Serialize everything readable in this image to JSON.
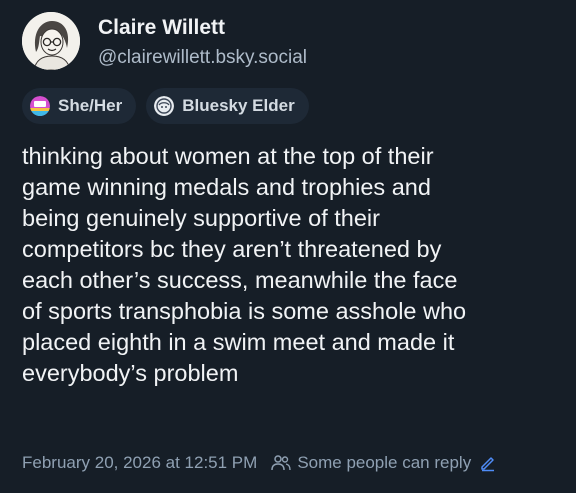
{
  "author": {
    "display_name": "Claire Willett",
    "handle": "@clairewillett.bsky.social",
    "avatar_icon": "user-avatar"
  },
  "badges": [
    {
      "label": "She/Her",
      "icon": "pronoun-badge-icon"
    },
    {
      "label": "Bluesky Elder",
      "icon": "elder-badge-icon"
    }
  ],
  "post": {
    "text": "thinking about women at the top of their\ngame winning medals and trophies and\nbeing genuinely supportive of their\ncompetitors bc they aren’t threatened by\neach other’s success, meanwhile the face\nof sports transphobia is some asshole who\nplaced eighth in a swim meet and made it\neverybody’s problem",
    "timestamp": "February 20, 2026 at 12:51 PM",
    "reply_setting": "Some people can reply"
  },
  "colors": {
    "background": "#161e27",
    "text": "#f1f3f5",
    "muted": "#8fa0b2",
    "accent": "#4f8cf7"
  }
}
